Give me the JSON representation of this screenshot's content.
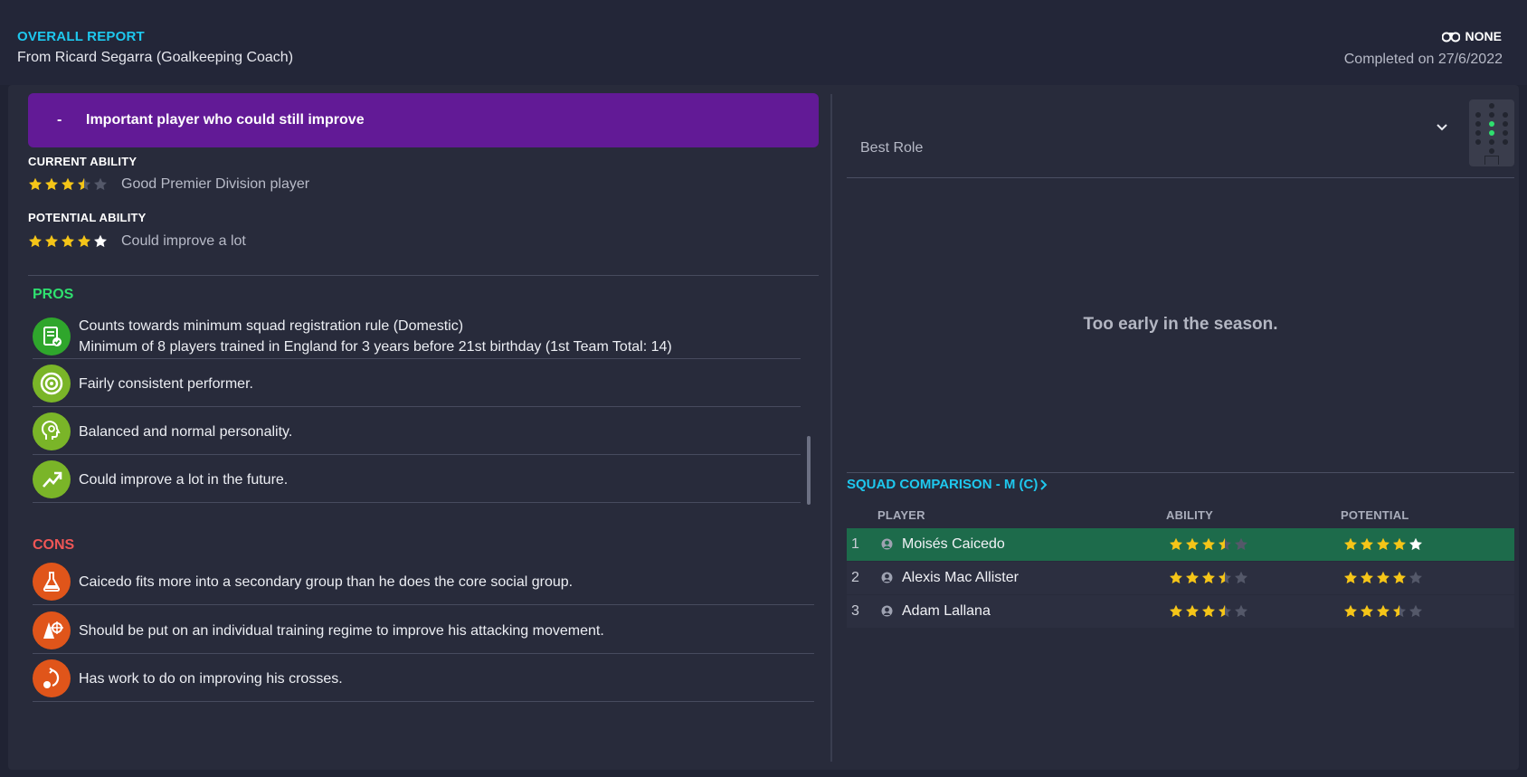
{
  "header": {
    "title": "OVERALL REPORT",
    "subtitle": "From Ricard Segarra (Goalkeeping Coach)",
    "scout_label": "NONE",
    "completed": "Completed on 27/6/2022"
  },
  "verdict": {
    "dash": "-",
    "text": "Important player who could still improve",
    "color": "#621a96"
  },
  "current_ability": {
    "label": "CURRENT ABILITY",
    "stars": 3.5,
    "max_stars": 5,
    "description": "Good Premier Division player"
  },
  "potential_ability": {
    "label": "POTENTIAL ABILITY",
    "stars": 5,
    "max_stars": 5,
    "description": "Could improve a lot"
  },
  "pros": {
    "title": "PROS",
    "items": [
      {
        "icon": "document-check-icon",
        "lines": [
          "Counts towards minimum squad registration rule (Domestic)",
          "Minimum of 8 players trained in England for 3 years before 21st birthday (1st Team Total: 14)"
        ]
      },
      {
        "icon": "target-icon",
        "lines": [
          "Fairly consistent performer."
        ]
      },
      {
        "icon": "head-gear-icon",
        "lines": [
          "Balanced and normal personality."
        ]
      },
      {
        "icon": "trend-up-icon",
        "lines": [
          "Could improve a lot in the future."
        ]
      }
    ]
  },
  "cons": {
    "title": "CONS",
    "items": [
      {
        "icon": "flask-icon",
        "text": "Caicedo fits more into a secondary group than he does the core social group."
      },
      {
        "icon": "cone-target-icon",
        "text": "Should be put on an individual training regime to improve his attacking movement."
      },
      {
        "icon": "ball-curve-icon",
        "text": "Has work to do on improving his crosses."
      }
    ]
  },
  "role": {
    "label": "Best Role",
    "empty_message": "Too early in the season."
  },
  "squad": {
    "title": "SQUAD COMPARISON - M (C)",
    "columns": {
      "player": "PLAYER",
      "ability": "ABILITY",
      "potential": "POTENTIAL"
    },
    "rows": [
      {
        "rank": "1",
        "name": "Moisés Caicedo",
        "ability": 3.5,
        "potential": 5,
        "selected": true
      },
      {
        "rank": "2",
        "name": "Alexis Mac Allister",
        "ability": 3.5,
        "potential": 4,
        "selected": false
      },
      {
        "rank": "3",
        "name": "Adam Lallana",
        "ability": 3.5,
        "potential": 3.5,
        "selected": false
      }
    ]
  },
  "colors": {
    "accent": "#1ec8ee",
    "pros": "#2fe06f",
    "cons": "#f05656",
    "star_gold": "#f5c518",
    "selected_row": "#1d6b4b"
  }
}
